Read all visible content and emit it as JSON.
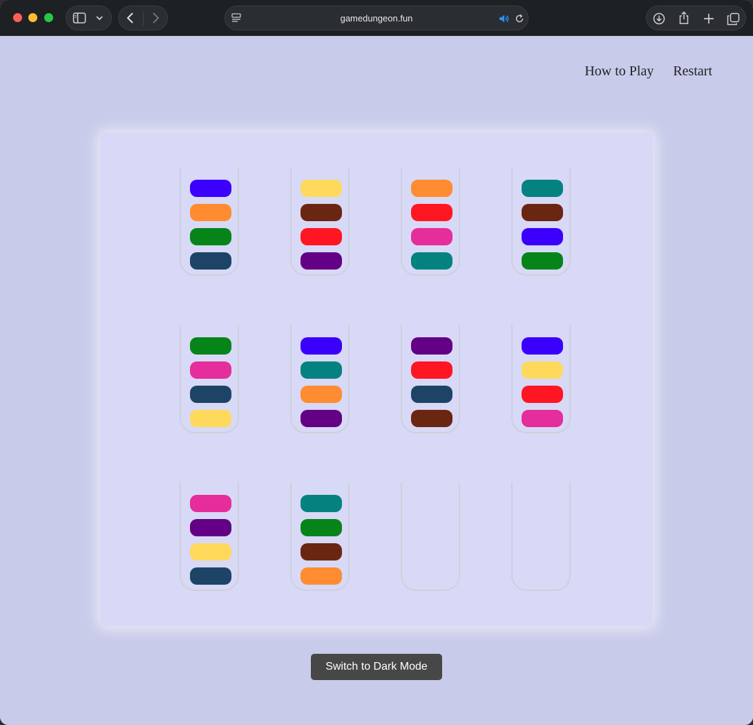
{
  "browser": {
    "url": "gamedungeon.fun"
  },
  "nav": {
    "how_to_play": "How to Play",
    "restart": "Restart"
  },
  "colors": {
    "blue": "#3a00fb",
    "orange": "#ff8c30",
    "green": "#06841a",
    "navy": "#1d4466",
    "yellow": "#ffd95c",
    "brown": "#6b2612",
    "red": "#ff1623",
    "purple": "#630086",
    "pink": "#e52d9b",
    "teal": "#048280"
  },
  "tubes": [
    [
      "blue",
      "orange",
      "green",
      "navy"
    ],
    [
      "yellow",
      "brown",
      "red",
      "purple"
    ],
    [
      "orange",
      "red",
      "pink",
      "teal"
    ],
    [
      "teal",
      "brown",
      "blue",
      "green"
    ],
    [
      "green",
      "pink",
      "navy",
      "yellow"
    ],
    [
      "blue",
      "teal",
      "orange",
      "purple"
    ],
    [
      "purple",
      "red",
      "navy",
      "brown"
    ],
    [
      "blue",
      "yellow",
      "red",
      "pink"
    ],
    [
      "pink",
      "purple",
      "yellow",
      "navy"
    ],
    [
      "teal",
      "green",
      "brown",
      "orange"
    ],
    [],
    []
  ],
  "footer": {
    "dark_mode_button": "Switch to Dark Mode"
  }
}
